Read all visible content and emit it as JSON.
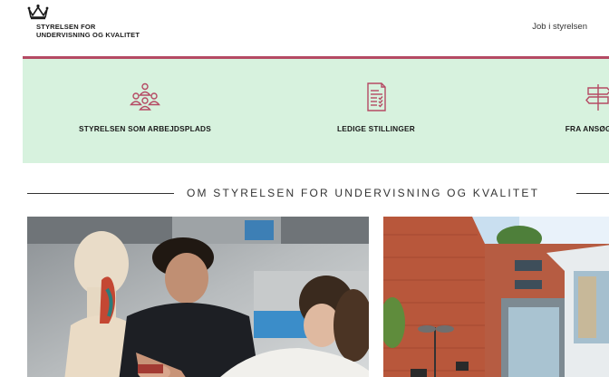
{
  "header": {
    "logo": {
      "line1": "STYRELSEN FOR",
      "line2": "UNDERVISNING OG KVALITET",
      "icon": "crown-icon"
    },
    "job_link": "Job i styrelsen"
  },
  "nav": {
    "accent_color": "#b54a64",
    "background_color": "#d7f2de",
    "items": [
      {
        "label": "STYRELSEN SOM ARBEJDSPLADS",
        "icon": "people-group-icon"
      },
      {
        "label": "LEDIGE STILLINGER",
        "icon": "job-document-icon"
      },
      {
        "label": "FRA ANSØGNING",
        "icon": "signpost-icon"
      }
    ]
  },
  "section": {
    "title": "OM STYRELSEN FOR UNDERVISNING OG KVALITET"
  },
  "cards": [
    {
      "image": "students-anatomy-model-photo"
    },
    {
      "image": "building-exterior-photo"
    }
  ]
}
